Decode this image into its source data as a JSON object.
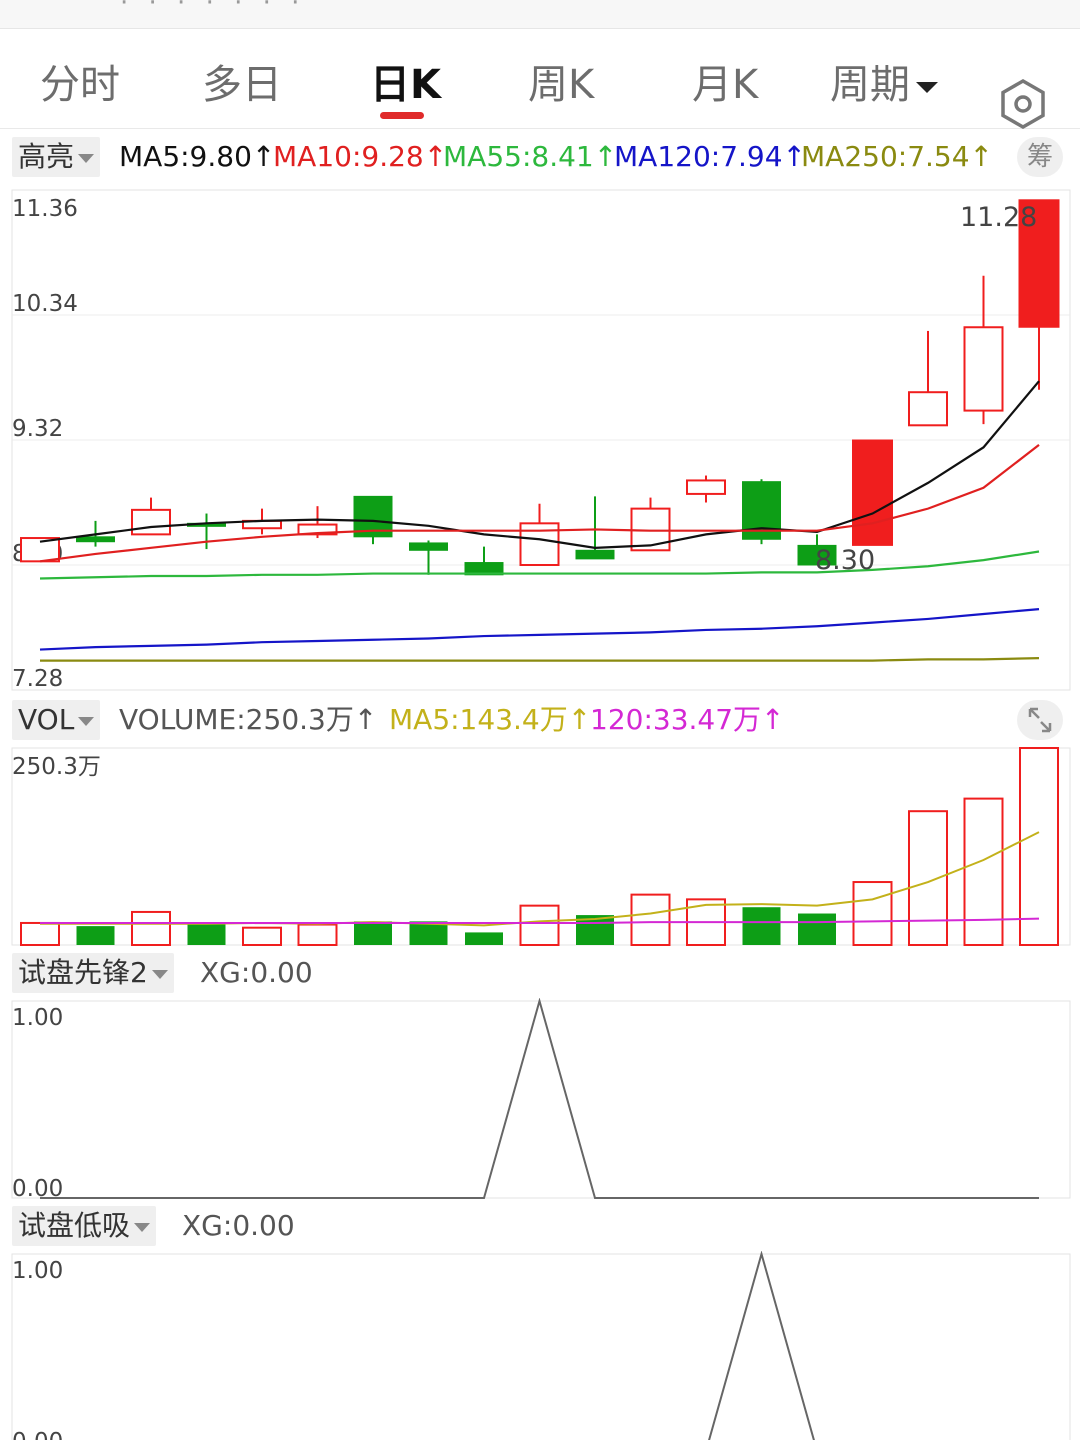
{
  "tabs": [
    {
      "label": "分时",
      "active": false
    },
    {
      "label": "多日",
      "active": false
    },
    {
      "label": "日K",
      "active": true
    },
    {
      "label": "周K",
      "active": false
    },
    {
      "label": "月K",
      "active": false
    },
    {
      "label": "周期",
      "active": false
    }
  ],
  "main": {
    "mode_label": "高亮",
    "ma_labels": [
      {
        "text": "MA5:9.80",
        "color": "#111111"
      },
      {
        "text": "MA10:9.28",
        "color": "#e02020"
      },
      {
        "text": "MA55:8.41",
        "color": "#2db83d"
      },
      {
        "text": "MA120:7.94",
        "color": "#1515c8"
      },
      {
        "text": "MA250:7.54",
        "color": "#8a8a10"
      }
    ],
    "chip_label": "筹",
    "high_annotation": "11.28",
    "low_annotation": "8.30"
  },
  "vol": {
    "mode_label": "VOL",
    "labels": [
      {
        "text": "VOLUME:250.3万",
        "color": "#555555"
      },
      {
        "text": "MA5:143.4万",
        "color": "#c3b11a"
      },
      {
        "text": "120:33.47万",
        "color": "#d428d4"
      }
    ],
    "max_label": "250.3万"
  },
  "ind1": {
    "mode_label": "试盘先锋2",
    "value_label": "XG:0.00",
    "ytick_top": "1.00",
    "ytick_bottom": "0.00"
  },
  "ind2": {
    "mode_label": "试盘低吸",
    "value_label": "XG:0.00",
    "ytick_top": "1.00",
    "ytick_bottom": "0.00"
  },
  "chart_data": [
    {
      "type": "candlestick",
      "yticks": [
        "11.36",
        "10.34",
        "9.32",
        "8.30",
        "7.28"
      ],
      "ylim": [
        7.28,
        11.36
      ],
      "candles": [
        {
          "o": 8.52,
          "h": 8.52,
          "l": 8.33,
          "c": 8.33,
          "dir": "up"
        },
        {
          "o": 8.53,
          "h": 8.66,
          "l": 8.45,
          "c": 8.49,
          "dir": "down"
        },
        {
          "o": 8.55,
          "h": 8.85,
          "l": 8.55,
          "c": 8.75,
          "dir": "up"
        },
        {
          "o": 8.64,
          "h": 8.72,
          "l": 8.43,
          "c": 8.62,
          "dir": "down"
        },
        {
          "o": 8.6,
          "h": 8.76,
          "l": 8.55,
          "c": 8.66,
          "dir": "up"
        },
        {
          "o": 8.55,
          "h": 8.78,
          "l": 8.52,
          "c": 8.63,
          "dir": "up"
        },
        {
          "o": 8.86,
          "h": 8.86,
          "l": 8.47,
          "c": 8.53,
          "dir": "down"
        },
        {
          "o": 8.48,
          "h": 8.5,
          "l": 8.22,
          "c": 8.42,
          "dir": "down"
        },
        {
          "o": 8.32,
          "h": 8.45,
          "l": 8.25,
          "c": 8.22,
          "dir": "down"
        },
        {
          "o": 8.3,
          "h": 8.8,
          "l": 8.3,
          "c": 8.64,
          "dir": "up"
        },
        {
          "o": 8.42,
          "h": 8.86,
          "l": 8.38,
          "c": 8.35,
          "dir": "down"
        },
        {
          "o": 8.42,
          "h": 8.85,
          "l": 8.42,
          "c": 8.76,
          "dir": "up"
        },
        {
          "o": 8.88,
          "h": 9.03,
          "l": 8.81,
          "c": 8.99,
          "dir": "up"
        },
        {
          "o": 8.98,
          "h": 9.0,
          "l": 8.47,
          "c": 8.51,
          "dir": "down"
        },
        {
          "o": 8.46,
          "h": 8.55,
          "l": 8.3,
          "c": 8.3,
          "dir": "down"
        },
        {
          "o": 8.46,
          "h": 9.32,
          "l": 8.46,
          "c": 9.32,
          "dir": "up"
        },
        {
          "o": 9.44,
          "h": 10.21,
          "l": 9.44,
          "c": 9.71,
          "dir": "up"
        },
        {
          "o": 9.56,
          "h": 10.66,
          "l": 9.45,
          "c": 10.24,
          "dir": "up"
        },
        {
          "o": 10.24,
          "h": 11.28,
          "l": 9.73,
          "c": 11.28,
          "dir": "up"
        }
      ],
      "series": [
        {
          "name": "MA5",
          "color": "#111111",
          "values": [
            8.49,
            8.55,
            8.61,
            8.64,
            8.66,
            8.67,
            8.66,
            8.62,
            8.55,
            8.51,
            8.44,
            8.46,
            8.55,
            8.6,
            8.57,
            8.72,
            8.97,
            9.26,
            9.8
          ]
        },
        {
          "name": "MA10",
          "color": "#e02020",
          "values": [
            8.33,
            8.39,
            8.44,
            8.49,
            8.53,
            8.56,
            8.58,
            8.58,
            8.58,
            8.58,
            8.59,
            8.58,
            8.58,
            8.58,
            8.58,
            8.64,
            8.76,
            8.93,
            9.28
          ]
        },
        {
          "name": "MA55",
          "color": "#2db83d",
          "values": [
            8.19,
            8.2,
            8.21,
            8.21,
            8.22,
            8.22,
            8.23,
            8.23,
            8.23,
            8.23,
            8.23,
            8.23,
            8.23,
            8.24,
            8.24,
            8.26,
            8.29,
            8.34,
            8.41
          ]
        },
        {
          "name": "MA120",
          "color": "#1515c8",
          "values": [
            7.61,
            7.63,
            7.64,
            7.65,
            7.67,
            7.68,
            7.69,
            7.7,
            7.72,
            7.73,
            7.74,
            7.75,
            7.77,
            7.78,
            7.8,
            7.83,
            7.86,
            7.9,
            7.94
          ]
        },
        {
          "name": "MA250",
          "color": "#8a8a10",
          "values": [
            7.52,
            7.52,
            7.52,
            7.52,
            7.52,
            7.52,
            7.52,
            7.52,
            7.52,
            7.52,
            7.52,
            7.52,
            7.52,
            7.52,
            7.52,
            7.52,
            7.53,
            7.53,
            7.54
          ]
        }
      ]
    },
    {
      "type": "bar",
      "ylim": [
        0,
        250.3
      ],
      "unit": "万",
      "values": [
        28,
        24,
        42,
        26,
        22,
        26,
        30,
        30,
        16,
        50,
        38,
        64,
        58,
        48,
        40,
        80,
        170,
        186,
        250.3
      ],
      "dirs": [
        "up",
        "down",
        "up",
        "down",
        "up",
        "up",
        "down",
        "down",
        "down",
        "up",
        "down",
        "up",
        "up",
        "down",
        "down",
        "up",
        "up",
        "up",
        "up"
      ],
      "series": [
        {
          "name": "MA5",
          "color": "#c3b11a",
          "values": [
            27,
            27,
            27,
            27,
            28,
            27,
            29,
            27,
            25,
            30,
            33,
            40,
            51,
            52,
            50,
            58,
            80,
            108,
            143.4
          ]
        },
        {
          "name": "120",
          "color": "#d428d4",
          "values": [
            28,
            28,
            28,
            28,
            28,
            28,
            28,
            28,
            28,
            28,
            28,
            29,
            29,
            29,
            29,
            30,
            31,
            32,
            33.47
          ]
        }
      ]
    },
    {
      "type": "line",
      "ylim": [
        0,
        1
      ],
      "values": [
        0,
        0,
        0,
        0,
        0,
        0,
        0,
        0,
        0,
        1,
        0,
        0,
        0,
        0,
        0,
        0,
        0,
        0,
        0
      ]
    },
    {
      "type": "line",
      "ylim": [
        0,
        1
      ],
      "values": [
        0,
        0,
        0,
        0,
        0,
        0,
        0,
        0,
        0,
        0,
        0,
        0,
        0,
        1,
        0,
        0,
        0,
        0,
        0
      ]
    }
  ]
}
